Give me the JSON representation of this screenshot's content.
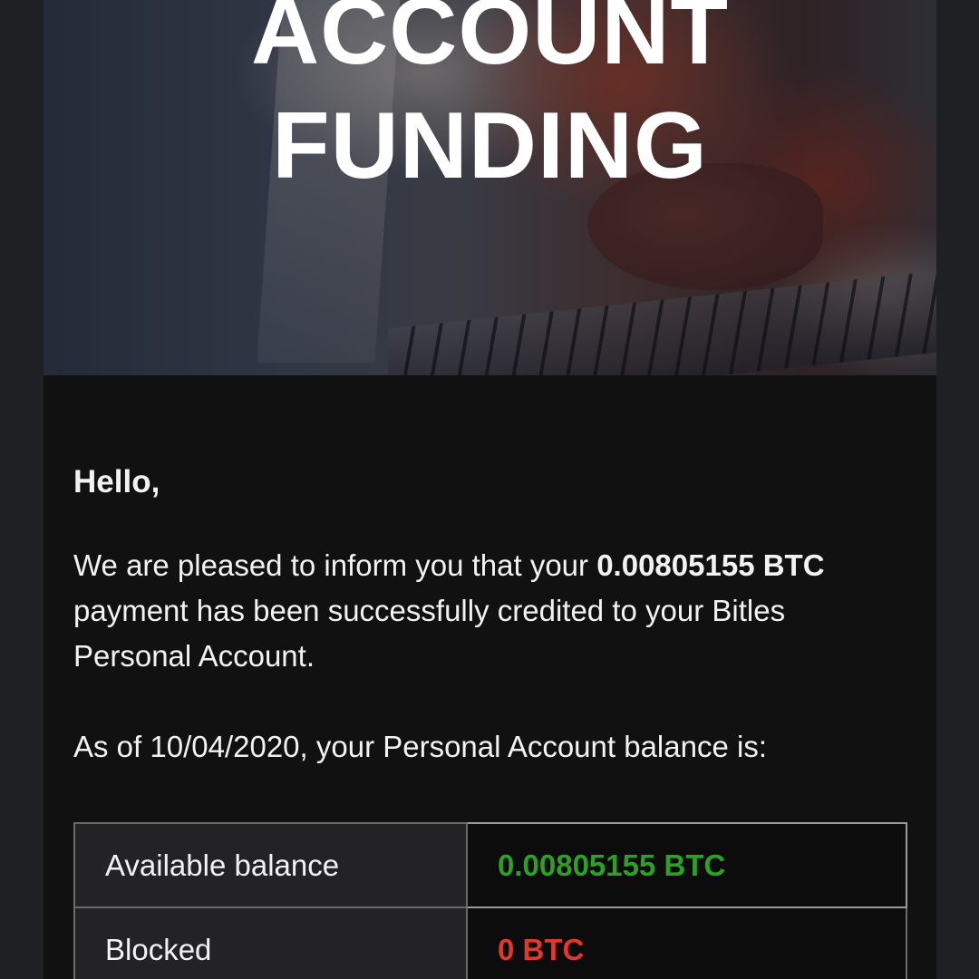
{
  "hero": {
    "title_line1": "ACCOUNT",
    "title_line2": "FUNDING"
  },
  "body": {
    "greeting": "Hello,",
    "message_pre": "We are pleased to inform you that your ",
    "message_amount": "0.00805155 BTC",
    "message_post": " payment has been successfully credited to your Bitles Personal Account.",
    "as_of": "As of 10/04/2020, your Personal Account balance is:"
  },
  "balance_table": {
    "rows": [
      {
        "label": "Available balance",
        "value": "0.00805155 BTC",
        "value_color": "#2ea02a"
      },
      {
        "label": "Blocked",
        "value": "0 BTC",
        "value_color": "#e1372c"
      }
    ]
  }
}
